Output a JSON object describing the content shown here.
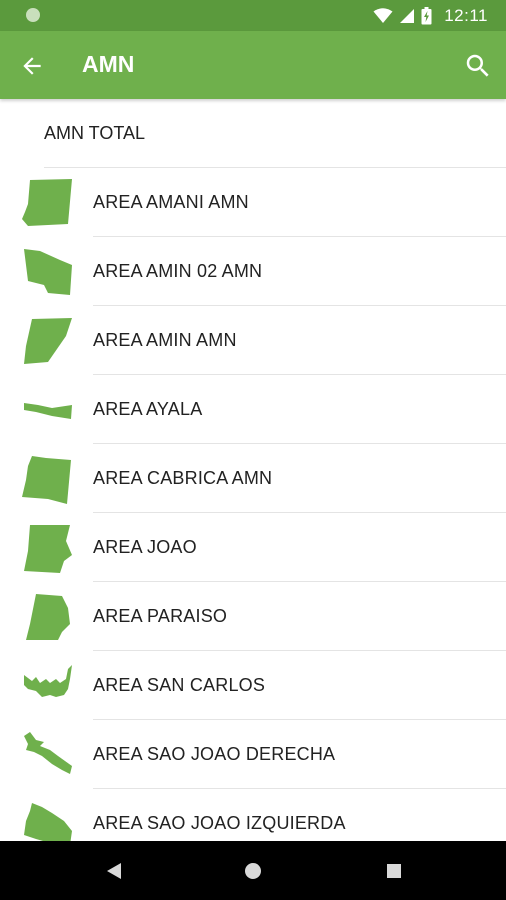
{
  "status_bar": {
    "time": "12:11",
    "icons": [
      "notification-dot-icon",
      "wifi-icon",
      "signal-icon",
      "battery-icon"
    ]
  },
  "app_bar": {
    "title": "AMN",
    "back_icon": "arrow-back-icon",
    "search_icon": "search-icon",
    "color": "#6fb04c"
  },
  "list": {
    "total_label": "AMN TOTAL",
    "shape_color": "#6fb04c",
    "items": [
      {
        "label": "AREA AMANI AMN",
        "icon": "area-shape-icon"
      },
      {
        "label": "AREA AMIN 02 AMN",
        "icon": "area-shape-icon"
      },
      {
        "label": "AREA AMIN AMN",
        "icon": "area-shape-icon"
      },
      {
        "label": "AREA AYALA",
        "icon": "area-shape-icon"
      },
      {
        "label": "AREA CABRICA AMN",
        "icon": "area-shape-icon"
      },
      {
        "label": "AREA JOAO",
        "icon": "area-shape-icon"
      },
      {
        "label": "AREA PARAISO",
        "icon": "area-shape-icon"
      },
      {
        "label": "AREA SAN CARLOS",
        "icon": "area-shape-icon"
      },
      {
        "label": "AREA SAO JOAO DERECHA",
        "icon": "area-shape-icon"
      },
      {
        "label": "AREA SAO JOAO IZQUIERDA",
        "icon": "area-shape-icon"
      }
    ]
  },
  "nav_bar": {
    "buttons": [
      "back-triangle-icon",
      "home-circle-icon",
      "recents-square-icon"
    ]
  }
}
